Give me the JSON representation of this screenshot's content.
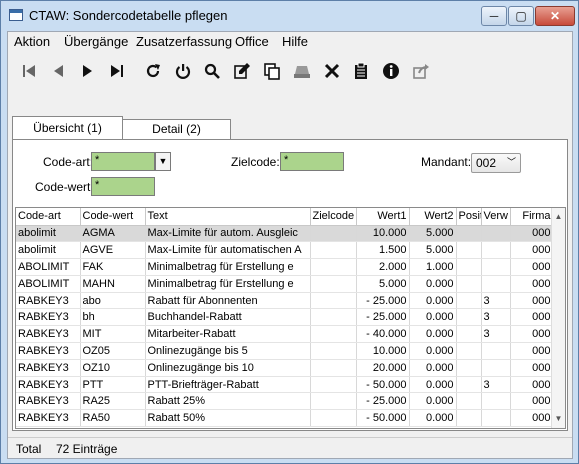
{
  "window": {
    "title": "CTAW: Sondercodetabelle pflegen",
    "minimize": "─",
    "maximize": "▢",
    "close": "✕"
  },
  "menu": [
    "Aktion",
    "Übergänge",
    "Zusatzerfassung",
    "Office",
    "Hilfe"
  ],
  "toolbar": {
    "icons": [
      "first-record-icon",
      "previous-record-icon",
      "next-record-icon",
      "last-record-icon",
      "refresh-icon",
      "power-icon",
      "search-icon",
      "edit-icon",
      "copy-icon",
      "print-icon",
      "delete-icon",
      "clipboard-icon",
      "info-icon",
      "export-icon"
    ]
  },
  "tabs": [
    {
      "label": "Übersicht (1)",
      "active": true
    },
    {
      "label": "Detail (2)",
      "active": false
    }
  ],
  "filters": {
    "code_art_label": "Code-art:",
    "code_art_value": "*",
    "zielcode_label": "Zielcode:",
    "zielcode_value": "*",
    "mandant_label": "Mandant:",
    "mandant_value": "002",
    "code_wert_label": "Code-wert:",
    "code_wert_value": "*"
  },
  "grid": {
    "columns": [
      "Code-art",
      "Code-wert",
      "Text",
      "Zielcode",
      "Wert1",
      "Wert2",
      "Posit",
      "Verw",
      "Firma"
    ],
    "rows": [
      [
        "abolimit",
        "AGMA",
        "Max-Limite für autom. Ausgleic",
        "",
        "10.000",
        "5.000",
        "",
        "",
        "000"
      ],
      [
        "abolimit",
        "AGVE",
        "Max-Limite für automatischen A",
        "",
        "1.500",
        "5.000",
        "",
        "",
        "000"
      ],
      [
        "ABOLIMIT",
        "FAK",
        "Minimalbetrag für Erstellung e",
        "",
        "2.000",
        "1.000",
        "",
        "",
        "000"
      ],
      [
        "ABOLIMIT",
        "MAHN",
        "Minimalbetrag für Erstellung e",
        "",
        "5.000",
        "0.000",
        "",
        "",
        "000"
      ],
      [
        "RABKEY3",
        "abo",
        "Rabatt für Abonnenten",
        "",
        "- 25.000",
        "0.000",
        "",
        "3",
        "000"
      ],
      [
        "RABKEY3",
        "bh",
        "Buchhandel-Rabatt",
        "",
        "- 25.000",
        "0.000",
        "",
        "3",
        "000"
      ],
      [
        "RABKEY3",
        "MIT",
        "Mitarbeiter-Rabatt",
        "",
        "- 40.000",
        "0.000",
        "",
        "3",
        "000"
      ],
      [
        "RABKEY3",
        "OZ05",
        "Onlinezugänge bis 5",
        "",
        "10.000",
        "0.000",
        "",
        "",
        "000"
      ],
      [
        "RABKEY3",
        "OZ10",
        "Onlinezugänge bis 10",
        "",
        "20.000",
        "0.000",
        "",
        "",
        "000"
      ],
      [
        "RABKEY3",
        "PTT",
        "PTT-Briefträger-Rabatt",
        "",
        "- 50.000",
        "0.000",
        "",
        "3",
        "000"
      ],
      [
        "RABKEY3",
        "RA25",
        "Rabatt 25%",
        "",
        "- 25.000",
        "0.000",
        "",
        "",
        "000"
      ],
      [
        "RABKEY3",
        "RA50",
        "Rabatt 50%",
        "",
        "- 50.000",
        "0.000",
        "",
        "",
        "000"
      ]
    ],
    "selected_row": 0
  },
  "status": {
    "total_label": "Total",
    "count_text": "72 Einträge"
  },
  "colors": {
    "filter_field": "#abd48c",
    "selected_row": "#d9d9d9",
    "close_button": "#c74a3a"
  }
}
